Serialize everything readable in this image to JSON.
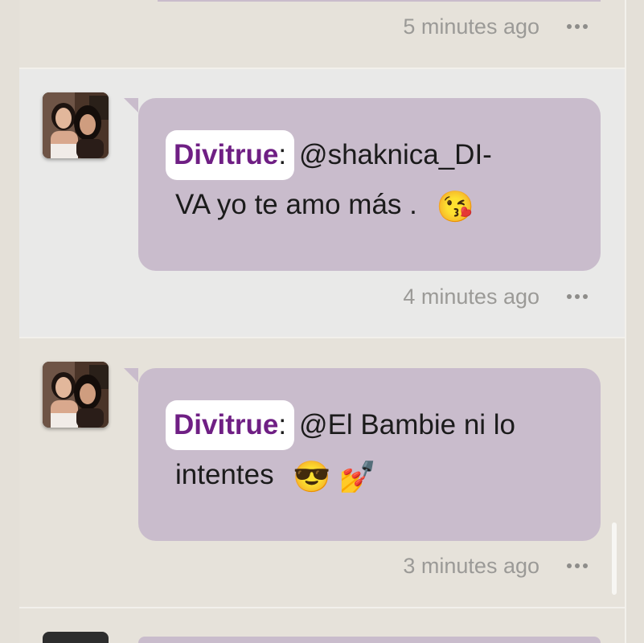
{
  "messages": [
    {
      "timestamp": "5 minutes ago",
      "more_icon": "more-options-icon"
    },
    {
      "author": "Divitrue",
      "colon": ":",
      "text_line1": "@shaknica_DI-",
      "text_line2": "VA yo te amo más .",
      "emoji1": "😘",
      "timestamp": "4 minutes ago",
      "more_icon": "more-options-icon"
    },
    {
      "author": "Divitrue",
      "colon": ":",
      "text_line1": "@El Bambie ni lo",
      "text_line2": "intentes",
      "emoji1": "😎",
      "emoji2": "💅",
      "timestamp": "3 minutes ago",
      "more_icon": "more-options-icon"
    }
  ],
  "colors": {
    "bubble": "#c9bccc",
    "author": "#6f1f84",
    "highlight_row": "#e9e9e8",
    "page_bg": "#e4e0d8"
  }
}
